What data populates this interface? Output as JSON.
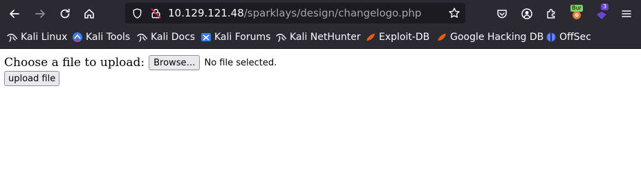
{
  "browser": {
    "url_host": "10.129.121.48",
    "url_path": "/sparklays/design/changelogo.php",
    "extensions": {
      "burp_label": "Bur",
      "badge_count": "3"
    }
  },
  "bookmarks": [
    {
      "label": "Kali Linux",
      "icon": "kali-dragon-icon"
    },
    {
      "label": "Kali Tools",
      "icon": "kali-tools-icon"
    },
    {
      "label": "Kali Docs",
      "icon": "kali-dragon-icon"
    },
    {
      "label": "Kali Forums",
      "icon": "kali-forums-icon"
    },
    {
      "label": "Kali NetHunter",
      "icon": "kali-dragon-icon"
    },
    {
      "label": "Exploit-DB",
      "icon": "exploit-db-icon"
    },
    {
      "label": "Google Hacking DB",
      "icon": "exploit-db-icon"
    },
    {
      "label": "OffSec",
      "icon": "offsec-icon"
    }
  ],
  "page": {
    "upload_label": "Choose a file to upload:",
    "browse_label": "Browse…",
    "file_status": "No file selected.",
    "upload_button": "upload file"
  },
  "colors": {
    "toolbar_bg": "#2b2a33",
    "urlbar_bg": "#1c1b22",
    "page_bg": "#ffffff"
  }
}
